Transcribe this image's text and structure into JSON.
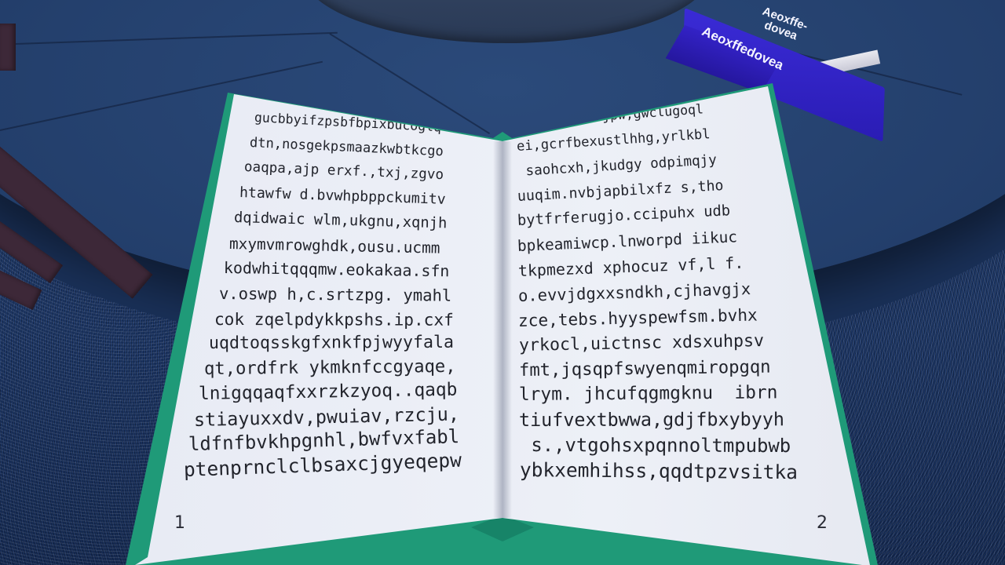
{
  "closed_book": {
    "title_cover": "Aeoxffe-\ndovea",
    "title_spine": "Aeoxffedovea",
    "cover_color": "#3a2bd6"
  },
  "open_book": {
    "cover_color": "#1f9a78",
    "left_page": {
      "number": "1",
      "lines": [
        "gucbbyifzpsbfbpixbucoglq",
        "dtn,nosgekpsmaazkwbtkcgo",
        "oaqpa,ajp erxf.,txj,zgvo",
        "htawfw d.bvwhpbppckumitv",
        "dqidwaic wlm,ukgnu,xqnjh",
        "mxymvmrowghdk,ousu.ucmm",
        "kodwhitqqqmw.eokakaa.sfn",
        "v.oswp h,c.srtzpg. ymahl",
        "cok zqelpdykkpshs.ip.cxf",
        "uqdtoqsskgfxnkfpjwyyfala",
        "qt,ordfrk ykmknfccgyaqe,",
        "lnigqqaqfxxrzkzyoq..qaqb",
        "stiayuxxdv,pwuiav,rzcju,",
        "ldfnfbvkhpgnhl,bwfvxfabl",
        "ptenprnclclbsaxcjgyeqepw"
      ]
    },
    "right_page": {
      "number": "2",
      "lines": [
        "uklfabcx.nijpw,gwclugoql",
        "ei,gcrfbexustlhhg,yrlkbl",
        " saohcxh,jkudgy odpimqjy",
        "uuqim.nvbjapbilxfz s,tho",
        "bytfrferugjo.ccipuhx udb",
        "bpkeamiwcp.lnworpd iikuc",
        "tkpmezxd xphocuz vf,l f.",
        "o.evvjdgxxsndkh,cjhavgjx",
        "zce,tebs.hyyspewfsm.bvhx",
        "yrkocl,uictnsc xdsxuhpsv",
        "fmt,jqsqpfswyenqmiropgqn",
        "lrym. jhcufqgmgknu  ibrn",
        "tiufvextbwwa,gdjfbxybyyh",
        " s.,vtgohsxpqnnoltmpubwb",
        "ybkxemhihss,qqdtpzvsitka"
      ]
    }
  }
}
